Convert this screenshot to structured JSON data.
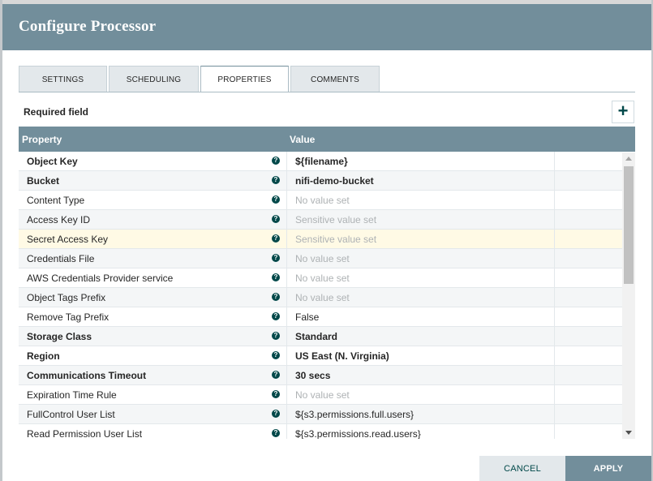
{
  "dialog": {
    "title": "Configure Processor"
  },
  "tabs": [
    {
      "label": "SETTINGS",
      "active": false
    },
    {
      "label": "SCHEDULING",
      "active": false
    },
    {
      "label": "PROPERTIES",
      "active": true
    },
    {
      "label": "COMMENTS",
      "active": false
    }
  ],
  "properties_panel": {
    "required_label": "Required field",
    "add_icon": "plus-icon",
    "add_glyph": "+",
    "help_glyph": "?",
    "columns": {
      "property": "Property",
      "value": "Value"
    },
    "rows": [
      {
        "name": "Object Key",
        "value": "${filename}",
        "required": true,
        "placeholder": false
      },
      {
        "name": "Bucket",
        "value": "nifi-demo-bucket",
        "required": true,
        "placeholder": false
      },
      {
        "name": "Content Type",
        "value": "No value set",
        "required": false,
        "placeholder": true
      },
      {
        "name": "Access Key ID",
        "value": "Sensitive value set",
        "required": false,
        "placeholder": true
      },
      {
        "name": "Secret Access Key",
        "value": "Sensitive value set",
        "required": false,
        "placeholder": true,
        "selected": true
      },
      {
        "name": "Credentials File",
        "value": "No value set",
        "required": false,
        "placeholder": true
      },
      {
        "name": "AWS Credentials Provider service",
        "value": "No value set",
        "required": false,
        "placeholder": true
      },
      {
        "name": "Object Tags Prefix",
        "value": "No value set",
        "required": false,
        "placeholder": true
      },
      {
        "name": "Remove Tag Prefix",
        "value": "False",
        "required": false,
        "placeholder": false
      },
      {
        "name": "Storage Class",
        "value": "Standard",
        "required": true,
        "placeholder": false
      },
      {
        "name": "Region",
        "value": "US East (N. Virginia)",
        "required": true,
        "placeholder": false
      },
      {
        "name": "Communications Timeout",
        "value": "30 secs",
        "required": true,
        "placeholder": false
      },
      {
        "name": "Expiration Time Rule",
        "value": "No value set",
        "required": false,
        "placeholder": true
      },
      {
        "name": "FullControl User List",
        "value": "${s3.permissions.full.users}",
        "required": false,
        "placeholder": false
      },
      {
        "name": "Read Permission User List",
        "value": "${s3.permissions.read.users}",
        "required": false,
        "placeholder": false
      }
    ]
  },
  "footer": {
    "cancel_label": "CANCEL",
    "apply_label": "APPLY"
  },
  "colors": {
    "header": "#728e9b",
    "accent": "#004849",
    "selected_row": "#fffae5"
  }
}
